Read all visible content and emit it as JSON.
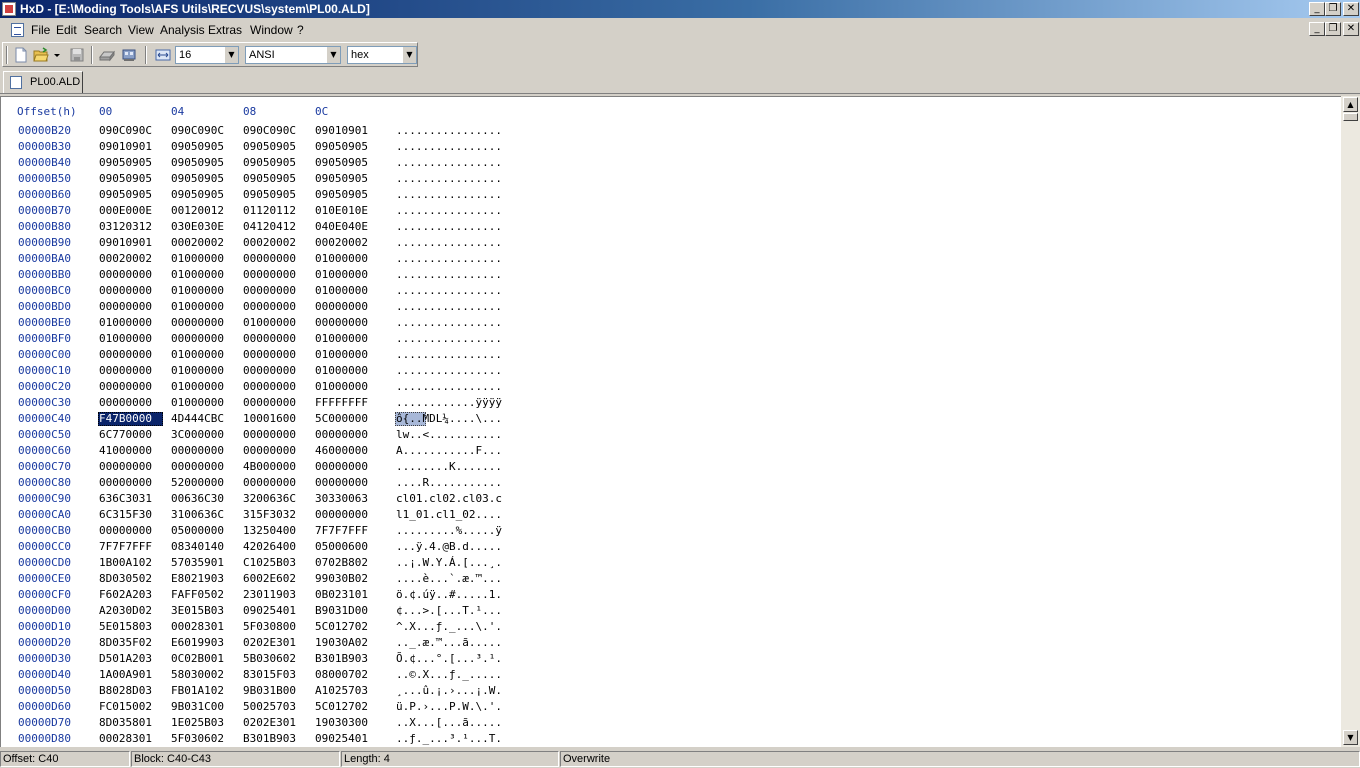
{
  "window": {
    "title": "HxD - [E:\\Moding Tools\\AFS Utils\\RECVUS\\system\\PL00.ALD]",
    "caption_buttons": [
      "_",
      "❐",
      "✕"
    ]
  },
  "menu": {
    "items": [
      "File",
      "Edit",
      "Search",
      "View",
      "Analysis",
      "Extras",
      "Window",
      "?"
    ]
  },
  "toolbar": {
    "bytes_per_row": "16",
    "charset": "ANSI",
    "offset_base": "hex"
  },
  "tab": {
    "label": "PL00.ALD"
  },
  "editor": {
    "header": {
      "offset": "Offset(h)",
      "columns": [
        "00",
        "04",
        "08",
        "0C"
      ]
    },
    "rows": [
      {
        "o": "00000B20",
        "h": [
          "090C090C",
          "090C090C",
          "090C090C",
          "09010901"
        ],
        "t": "................"
      },
      {
        "o": "00000B30",
        "h": [
          "09010901",
          "09050905",
          "09050905",
          "09050905"
        ],
        "t": "................"
      },
      {
        "o": "00000B40",
        "h": [
          "09050905",
          "09050905",
          "09050905",
          "09050905"
        ],
        "t": "................"
      },
      {
        "o": "00000B50",
        "h": [
          "09050905",
          "09050905",
          "09050905",
          "09050905"
        ],
        "t": "................"
      },
      {
        "o": "00000B60",
        "h": [
          "09050905",
          "09050905",
          "09050905",
          "09050905"
        ],
        "t": "................"
      },
      {
        "o": "00000B70",
        "h": [
          "000E000E",
          "00120012",
          "01120112",
          "010E010E"
        ],
        "t": "................"
      },
      {
        "o": "00000B80",
        "h": [
          "03120312",
          "030E030E",
          "04120412",
          "040E040E"
        ],
        "t": "................"
      },
      {
        "o": "00000B90",
        "h": [
          "09010901",
          "00020002",
          "00020002",
          "00020002"
        ],
        "t": "................"
      },
      {
        "o": "00000BA0",
        "h": [
          "00020002",
          "01000000",
          "00000000",
          "01000000"
        ],
        "t": "................"
      },
      {
        "o": "00000BB0",
        "h": [
          "00000000",
          "01000000",
          "00000000",
          "01000000"
        ],
        "t": "................"
      },
      {
        "o": "00000BC0",
        "h": [
          "00000000",
          "01000000",
          "00000000",
          "01000000"
        ],
        "t": "................"
      },
      {
        "o": "00000BD0",
        "h": [
          "00000000",
          "01000000",
          "00000000",
          "00000000"
        ],
        "t": "................"
      },
      {
        "o": "00000BE0",
        "h": [
          "01000000",
          "00000000",
          "01000000",
          "00000000"
        ],
        "t": "................"
      },
      {
        "o": "00000BF0",
        "h": [
          "01000000",
          "00000000",
          "00000000",
          "01000000"
        ],
        "t": "................"
      },
      {
        "o": "00000C00",
        "h": [
          "00000000",
          "01000000",
          "00000000",
          "01000000"
        ],
        "t": "................"
      },
      {
        "o": "00000C10",
        "h": [
          "00000000",
          "01000000",
          "00000000",
          "01000000"
        ],
        "t": "................"
      },
      {
        "o": "00000C20",
        "h": [
          "00000000",
          "01000000",
          "00000000",
          "01000000"
        ],
        "t": "................"
      },
      {
        "o": "00000C30",
        "h": [
          "00000000",
          "01000000",
          "00000000",
          "FFFFFFFF"
        ],
        "t": "............ÿÿÿÿ"
      },
      {
        "o": "00000C40",
        "h": [
          "F47B0000",
          "4D444CBC",
          "10001600",
          "5C000000"
        ],
        "t": "ô{..MDL¼....\\..."
      },
      {
        "o": "00000C50",
        "h": [
          "6C770000",
          "3C000000",
          "00000000",
          "00000000"
        ],
        "t": "lw..<..........."
      },
      {
        "o": "00000C60",
        "h": [
          "41000000",
          "00000000",
          "00000000",
          "46000000"
        ],
        "t": "A...........F..."
      },
      {
        "o": "00000C70",
        "h": [
          "00000000",
          "00000000",
          "4B000000",
          "00000000"
        ],
        "t": "........K......."
      },
      {
        "o": "00000C80",
        "h": [
          "00000000",
          "52000000",
          "00000000",
          "00000000"
        ],
        "t": "....R..........."
      },
      {
        "o": "00000C90",
        "h": [
          "636C3031",
          "00636C30",
          "3200636C",
          "30330063"
        ],
        "t": "cl01.cl02.cl03.c"
      },
      {
        "o": "00000CA0",
        "h": [
          "6C315F30",
          "3100636C",
          "315F3032",
          "00000000"
        ],
        "t": "l1_01.cl1_02...."
      },
      {
        "o": "00000CB0",
        "h": [
          "00000000",
          "05000000",
          "13250400",
          "7F7F7FFF"
        ],
        "t": ".........%.....ÿ"
      },
      {
        "o": "00000CC0",
        "h": [
          "7F7F7FFF",
          "08340140",
          "42026400",
          "05000600"
        ],
        "t": "...ÿ.4.@B.d....."
      },
      {
        "o": "00000CD0",
        "h": [
          "1B00A102",
          "57035901",
          "C1025B03",
          "0702B802"
        ],
        "t": "..¡.W.Y.Á.[...¸."
      },
      {
        "o": "00000CE0",
        "h": [
          "8D030502",
          "E8021903",
          "6002E602",
          "99030B02"
        ],
        "t": "....è...`.æ.™..."
      },
      {
        "o": "00000CF0",
        "h": [
          "F602A203",
          "FAFF0502",
          "23011903",
          "0B023101"
        ],
        "t": "ö.¢.úÿ..#.....1."
      },
      {
        "o": "00000D00",
        "h": [
          "A2030D02",
          "3E015B03",
          "09025401",
          "B9031D00"
        ],
        "t": "¢...>.[...T.¹..."
      },
      {
        "o": "00000D10",
        "h": [
          "5E015803",
          "00028301",
          "5F030800",
          "5C012702"
        ],
        "t": "^.X...ƒ._...\\.'."
      },
      {
        "o": "00000D20",
        "h": [
          "8D035F02",
          "E6019903",
          "0202E301",
          "19030A02"
        ],
        "t": ".._.æ.™...ã....."
      },
      {
        "o": "00000D30",
        "h": [
          "D501A203",
          "0C02B001",
          "5B030602",
          "B301B903"
        ],
        "t": "Õ.¢...°.[...³.¹."
      },
      {
        "o": "00000D40",
        "h": [
          "1A00A901",
          "58030002",
          "83015F03",
          "08000702"
        ],
        "t": "..©.X...ƒ._....."
      },
      {
        "o": "00000D50",
        "h": [
          "B8028D03",
          "FB01A102",
          "9B031B00",
          "A1025703"
        ],
        "t": "¸...û.¡.›...¡.W."
      },
      {
        "o": "00000D60",
        "h": [
          "FC015002",
          "9B031C00",
          "50025703",
          "5C012702"
        ],
        "t": "ü.P.›...P.W.\\.'."
      },
      {
        "o": "00000D70",
        "h": [
          "8D035801",
          "1E025B03",
          "0202E301",
          "19030300"
        ],
        "t": "..X...[...ã....."
      },
      {
        "o": "00000D80",
        "h": [
          "00028301",
          "5F030602",
          "B301B903",
          "09025401"
        ],
        "t": "..ƒ._...³.¹...T."
      }
    ]
  },
  "status": {
    "offset": "Offset: C40",
    "block": "Block: C40-C43",
    "length": "Length: 4",
    "mode": "Overwrite"
  }
}
